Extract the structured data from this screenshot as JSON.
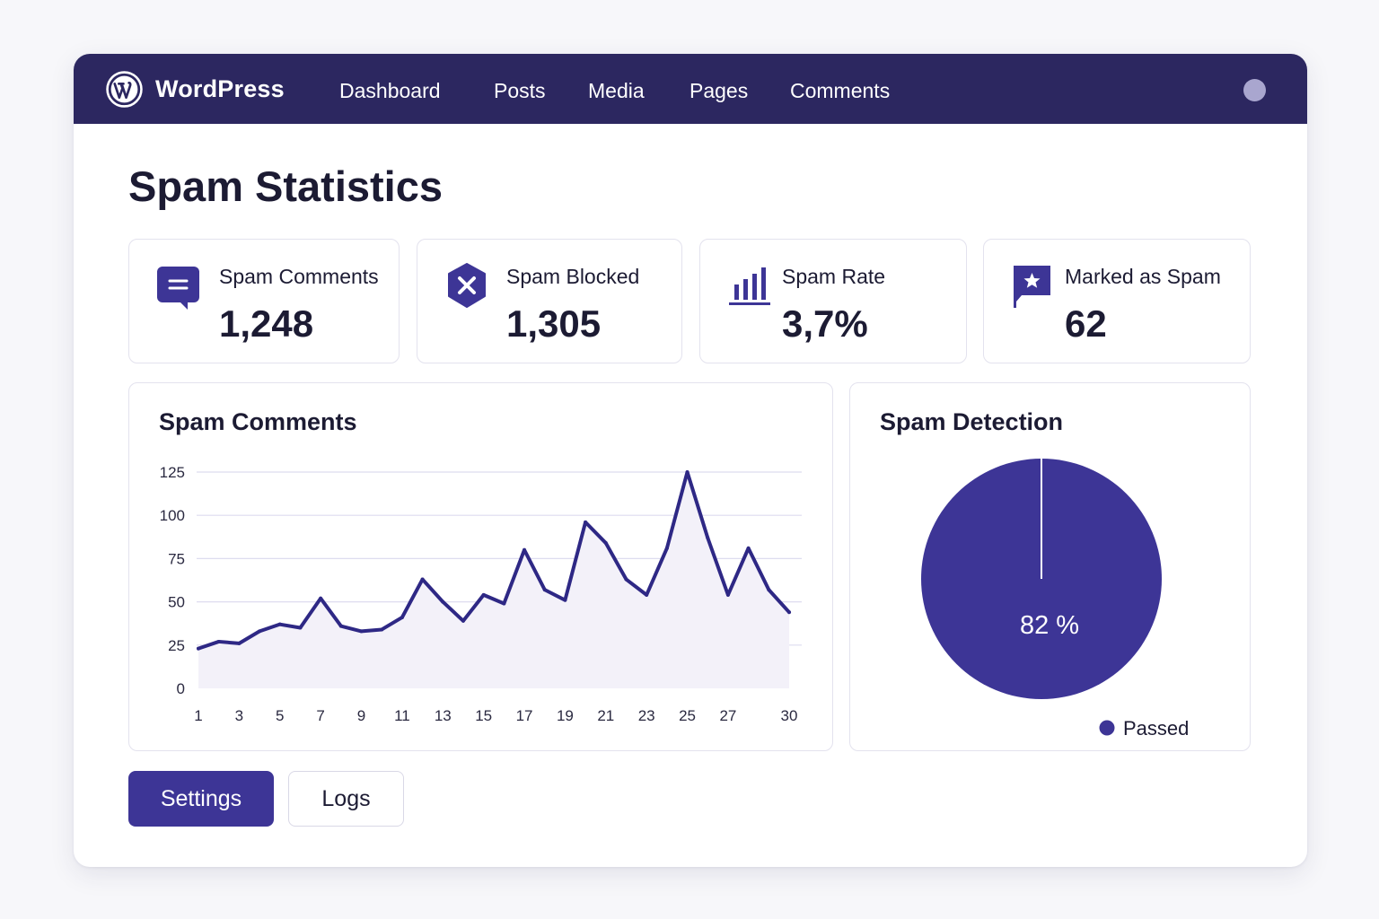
{
  "colors": {
    "nav_bg": "#2c2760",
    "accent": "#3d3596",
    "line": "#2e2885",
    "area_fill": "#f3f1f9",
    "gridline": "#dedcef",
    "page_bg": "#f7f7fa"
  },
  "header": {
    "logo_icon": "wordpress-logo-icon",
    "brand": "WordPress",
    "nav": [
      {
        "label": "Dashboard"
      },
      {
        "label": "Posts"
      },
      {
        "label": "Media"
      },
      {
        "label": "Pages"
      },
      {
        "label": "Comments"
      }
    ],
    "avatar_icon": "user-avatar-icon"
  },
  "page": {
    "title": "Spam Statistics"
  },
  "stats": [
    {
      "icon": "speech-bubble-icon",
      "label": "Spam Comments",
      "value": "1,248"
    },
    {
      "icon": "shield-x-icon",
      "label": "Spam Blocked",
      "value": "1,305"
    },
    {
      "icon": "bar-chart-icon",
      "label": "Spam Rate",
      "value": "3,7%"
    },
    {
      "icon": "flag-star-icon",
      "label": "Marked as Spam",
      "value": "62"
    }
  ],
  "line_panel": {
    "title": "Spam Comments"
  },
  "pie_panel": {
    "title": "Spam Detection"
  },
  "chart_data": [
    {
      "type": "area",
      "title": "Spam Comments",
      "x": [
        1,
        2,
        3,
        4,
        5,
        6,
        7,
        8,
        9,
        10,
        11,
        12,
        13,
        14,
        15,
        16,
        17,
        18,
        19,
        20,
        21,
        22,
        23,
        24,
        25,
        26,
        27,
        28,
        29,
        30
      ],
      "series": [
        {
          "values": [
            23,
            27,
            26,
            33,
            37,
            35,
            52,
            36,
            33,
            34,
            41,
            63,
            50,
            39,
            54,
            49,
            80,
            57,
            51,
            96,
            84,
            63,
            54,
            81,
            125,
            87,
            54,
            81,
            57,
            44
          ]
        }
      ],
      "x_tick_labels": [
        "1",
        "3",
        "5",
        "7",
        "9",
        "11",
        "13",
        "15",
        "17",
        "19",
        "21",
        "23",
        "25",
        "27",
        "30"
      ],
      "y_tick_labels": [
        "0",
        "25",
        "50",
        "75",
        "100",
        "125"
      ],
      "ylim": [
        0,
        125
      ],
      "xlim": [
        1,
        30
      ],
      "grid": true
    },
    {
      "type": "pie",
      "title": "Spam Detection",
      "slices": [
        {
          "label": "Passed",
          "value": 100
        }
      ],
      "center_label": "82 %",
      "legend": [
        {
          "label": "Passed"
        }
      ],
      "legend_placement": "bottom-right"
    }
  ],
  "buttons": {
    "settings": "Settings",
    "logs": "Logs"
  }
}
